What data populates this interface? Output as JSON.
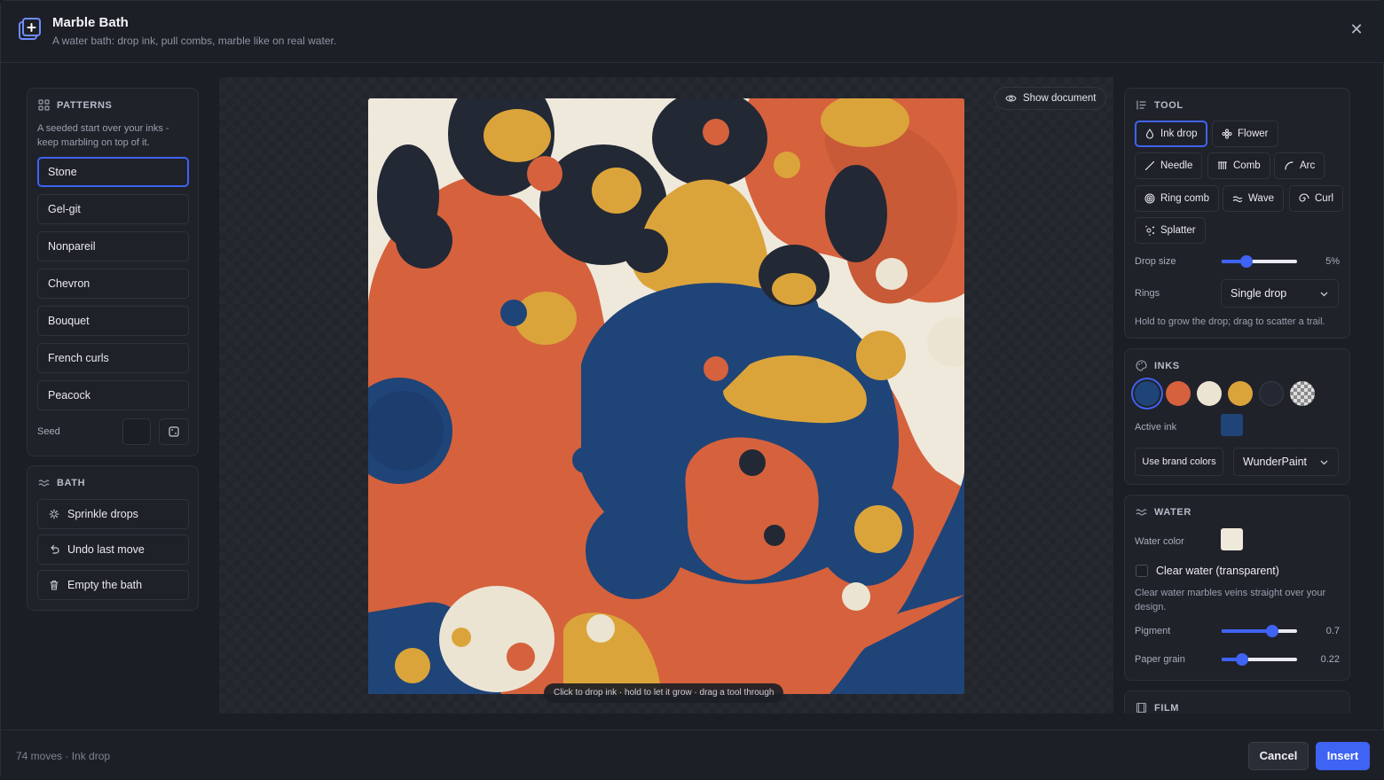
{
  "header": {
    "title": "Marble Bath",
    "subtitle": "A water bath: drop ink, pull combs, marble like on real water."
  },
  "patterns": {
    "title": "PATTERNS",
    "hint": "A seeded start over your inks - keep marbling on top of it.",
    "items": [
      "Stone",
      "Gel-git",
      "Nonpareil",
      "Chevron",
      "Bouquet",
      "French curls",
      "Peacock"
    ],
    "active": "Stone",
    "seed_label": "Seed",
    "seed_value": ""
  },
  "bath": {
    "title": "BATH",
    "sprinkle": "Sprinkle drops",
    "undo": "Undo last move",
    "empty": "Empty the bath"
  },
  "canvas": {
    "show_document": "Show document",
    "hint": "Click to drop ink · hold to let it grow · drag a tool through",
    "water_color": "#efe9dc",
    "inks": {
      "blue": "#1f4478",
      "orange": "#d5623d",
      "cream": "#ece4d2",
      "gold": "#dba43a",
      "navy": "#222733"
    }
  },
  "tool": {
    "title": "TOOL",
    "buttons": [
      "Ink drop",
      "Flower",
      "Needle",
      "Comb",
      "Arc",
      "Ring comb",
      "Wave",
      "Curl",
      "Splatter"
    ],
    "active": "Ink drop",
    "drop_size_label": "Drop size",
    "drop_size_value": "5%",
    "drop_size_fraction": 0.29,
    "rings_label": "Rings",
    "rings_value": "Single drop",
    "hint": "Hold to grow the drop; drag to scatter a trail."
  },
  "inks": {
    "title": "INKS",
    "swatches": [
      "#1f4478",
      "#d5623d",
      "#ece4d2",
      "#dba43a",
      "#242833",
      "transparent"
    ],
    "active_index": 0,
    "active_ink_label": "Active ink",
    "active_ink_color": "#1f4478",
    "brand_button": "Use brand colors",
    "brand_value": "WunderPaint"
  },
  "water": {
    "title": "WATER",
    "water_color_label": "Water color",
    "water_color": "#efe9dc",
    "clear_label": "Clear water (transparent)",
    "clear_checked": false,
    "hint": "Clear water marbles veins straight over your design.",
    "pigment_label": "Pigment",
    "pigment_value": "0.7",
    "pigment_fraction": 0.7,
    "grain_label": "Paper grain",
    "grain_value": "0.22",
    "grain_fraction": 0.22
  },
  "film": {
    "title": "FILM"
  },
  "footer": {
    "status": "74 moves · Ink drop",
    "cancel": "Cancel",
    "insert": "Insert"
  },
  "colors": {
    "accent": "#3f63f2",
    "panel": "#20222a",
    "border": "#2d3039"
  }
}
